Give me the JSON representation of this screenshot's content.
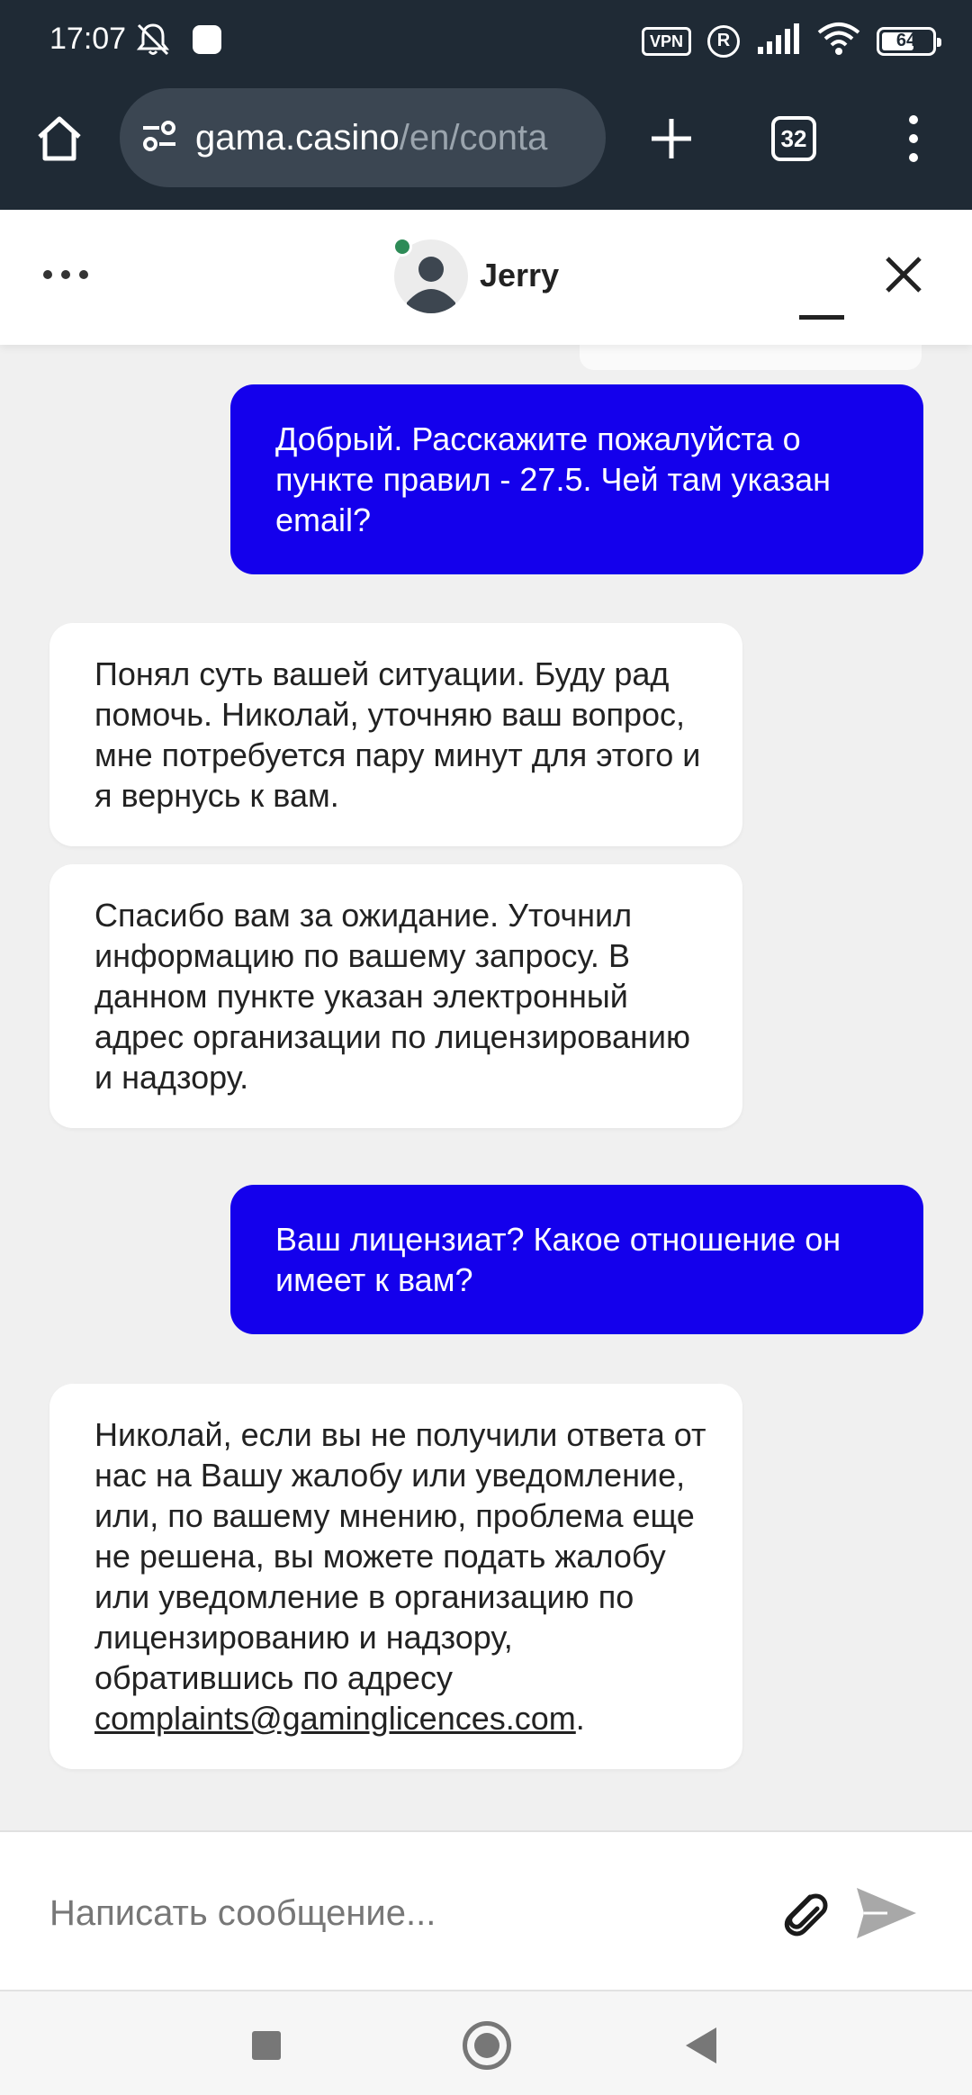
{
  "status_bar": {
    "time": "17:07",
    "vpn_label": "VPN",
    "roaming_label": "R",
    "battery_level": "64",
    "icons": [
      "mute-icon",
      "notification-square-icon",
      "vpn-icon",
      "roaming-icon",
      "signal-icon",
      "wifi-icon",
      "battery-icon"
    ]
  },
  "browser": {
    "url_domain": "gama.casino",
    "url_path": "/en/conta",
    "tab_count": "32",
    "icons": [
      "home-icon",
      "site-settings-icon",
      "plus-icon",
      "tabs-icon",
      "more-vert-icon"
    ]
  },
  "chat_header": {
    "agent_name": "Jerry",
    "online_status_color": "#2e8b57",
    "icons": [
      "more-horiz-icon",
      "avatar-icon",
      "minimize-icon",
      "close-icon"
    ]
  },
  "messages": [
    {
      "from": "user",
      "text": "Добрый. Расскажите пожалуйста о пункте правил - 27.5. Чей там указан email?"
    },
    {
      "from": "agent",
      "text": "Понял суть вашей ситуации. Буду рад помочь. Николай, уточняю ваш вопрос, мне потребуется пару минут для этого и я вернусь к вам."
    },
    {
      "from": "agent",
      "text": "Спасибо вам за ожидание. Уточнил информацию по вашему запросу. В данном пункте указан электронный адрес организации по лицензированию и надзору."
    },
    {
      "from": "user",
      "text": "Ваш лицензиат? Какое отношение он имеет к вам?"
    },
    {
      "from": "agent",
      "text": "Николай, если вы не получили ответа от нас на Вашу жалобу или уведомление, или, по вашему мнению, проблема еще не решена, вы можете подать жалобу или уведомление в организацию по лицензированию и надзору, обратившись по адресу",
      "link": "complaints@gaminglicences.com",
      "suffix": "."
    }
  ],
  "composer": {
    "placeholder": "Написать сообщение...",
    "icons": [
      "paperclip-icon",
      "send-icon"
    ]
  },
  "colors": {
    "user_bubble": "#1400ec",
    "agent_bubble": "#ffffff",
    "chat_background": "#f0f0f0",
    "browser_chrome": "#1f2a35"
  }
}
